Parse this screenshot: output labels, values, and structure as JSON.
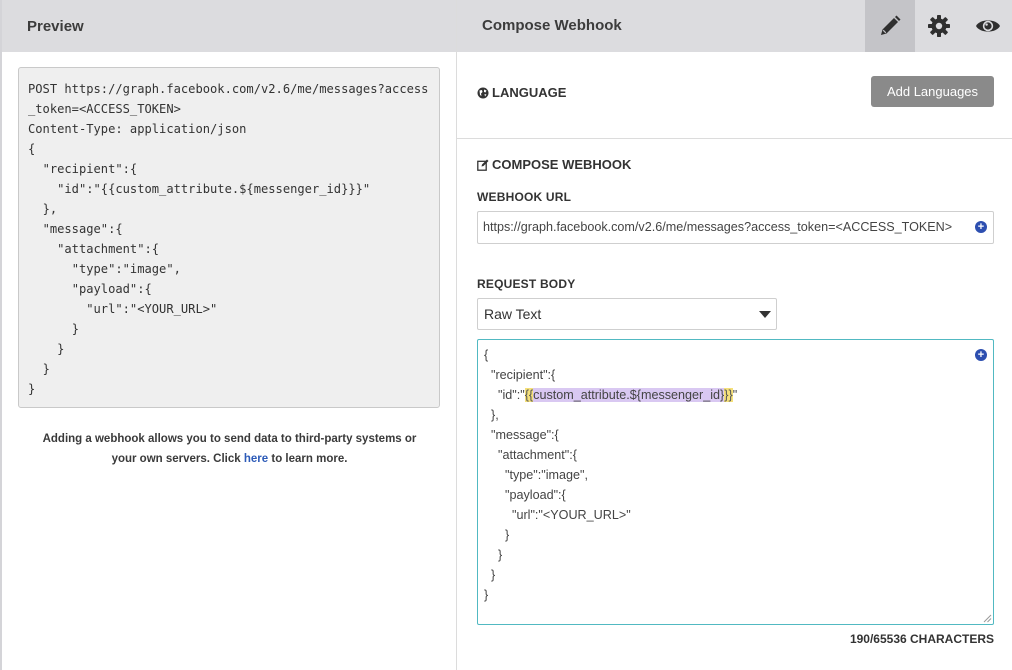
{
  "preview": {
    "header": "Preview",
    "code": "POST https://graph.facebook.com/v2.6/me/messages?access_token=<ACCESS_TOKEN>\nContent-Type: application/json\n{\n  \"recipient\":{\n    \"id\":\"{{custom_attribute.${messenger_id}}}\"\n  },\n  \"message\":{\n    \"attachment\":{\n      \"type\":\"image\",\n      \"payload\":{\n        \"url\":\"<YOUR_URL>\"\n      }\n    }\n  }\n}",
    "info_before": "Adding a webhook allows you to send data to third-party systems or your own servers. Click ",
    "info_link": "here",
    "info_after": " to learn more."
  },
  "compose": {
    "header": "Compose Webhook",
    "toolbar": {
      "edit_icon": "pencil-icon",
      "settings_icon": "gear-icon",
      "preview_icon": "eye-icon"
    },
    "language": {
      "title": "LANGUAGE",
      "icon": "globe-icon",
      "add_button": "Add Languages"
    },
    "section_title": "COMPOSE WEBHOOK",
    "section_icon": "edit-icon",
    "webhook_url": {
      "label": "WEBHOOK URL",
      "value": "https://graph.facebook.com/v2.6/me/messages?access_token=<ACCESS_TOKEN>"
    },
    "request_body": {
      "label": "REQUEST BODY",
      "format": "Raw Text",
      "lines_before": "{\n  \"recipient\":{\n    \"id\":\"",
      "liquid_open": "{{",
      "liquid_var": "custom_attribute.${messenger_id}",
      "liquid_close": "}}",
      "lines_after": "\"\n  },\n  \"message\":{\n    \"attachment\":{\n      \"type\":\"image\",\n      \"payload\":{\n        \"url\":\"<YOUR_URL>\"\n      }\n    }\n  }\n}"
    },
    "char_count": "190/65536 CHARACTERS"
  },
  "colors": {
    "header_bg": "#dcdcdf",
    "active_tool": "#c4c4c8",
    "accent": "#51b9c2",
    "link": "#2d5bb8",
    "highlight": "#d9c8f2"
  }
}
